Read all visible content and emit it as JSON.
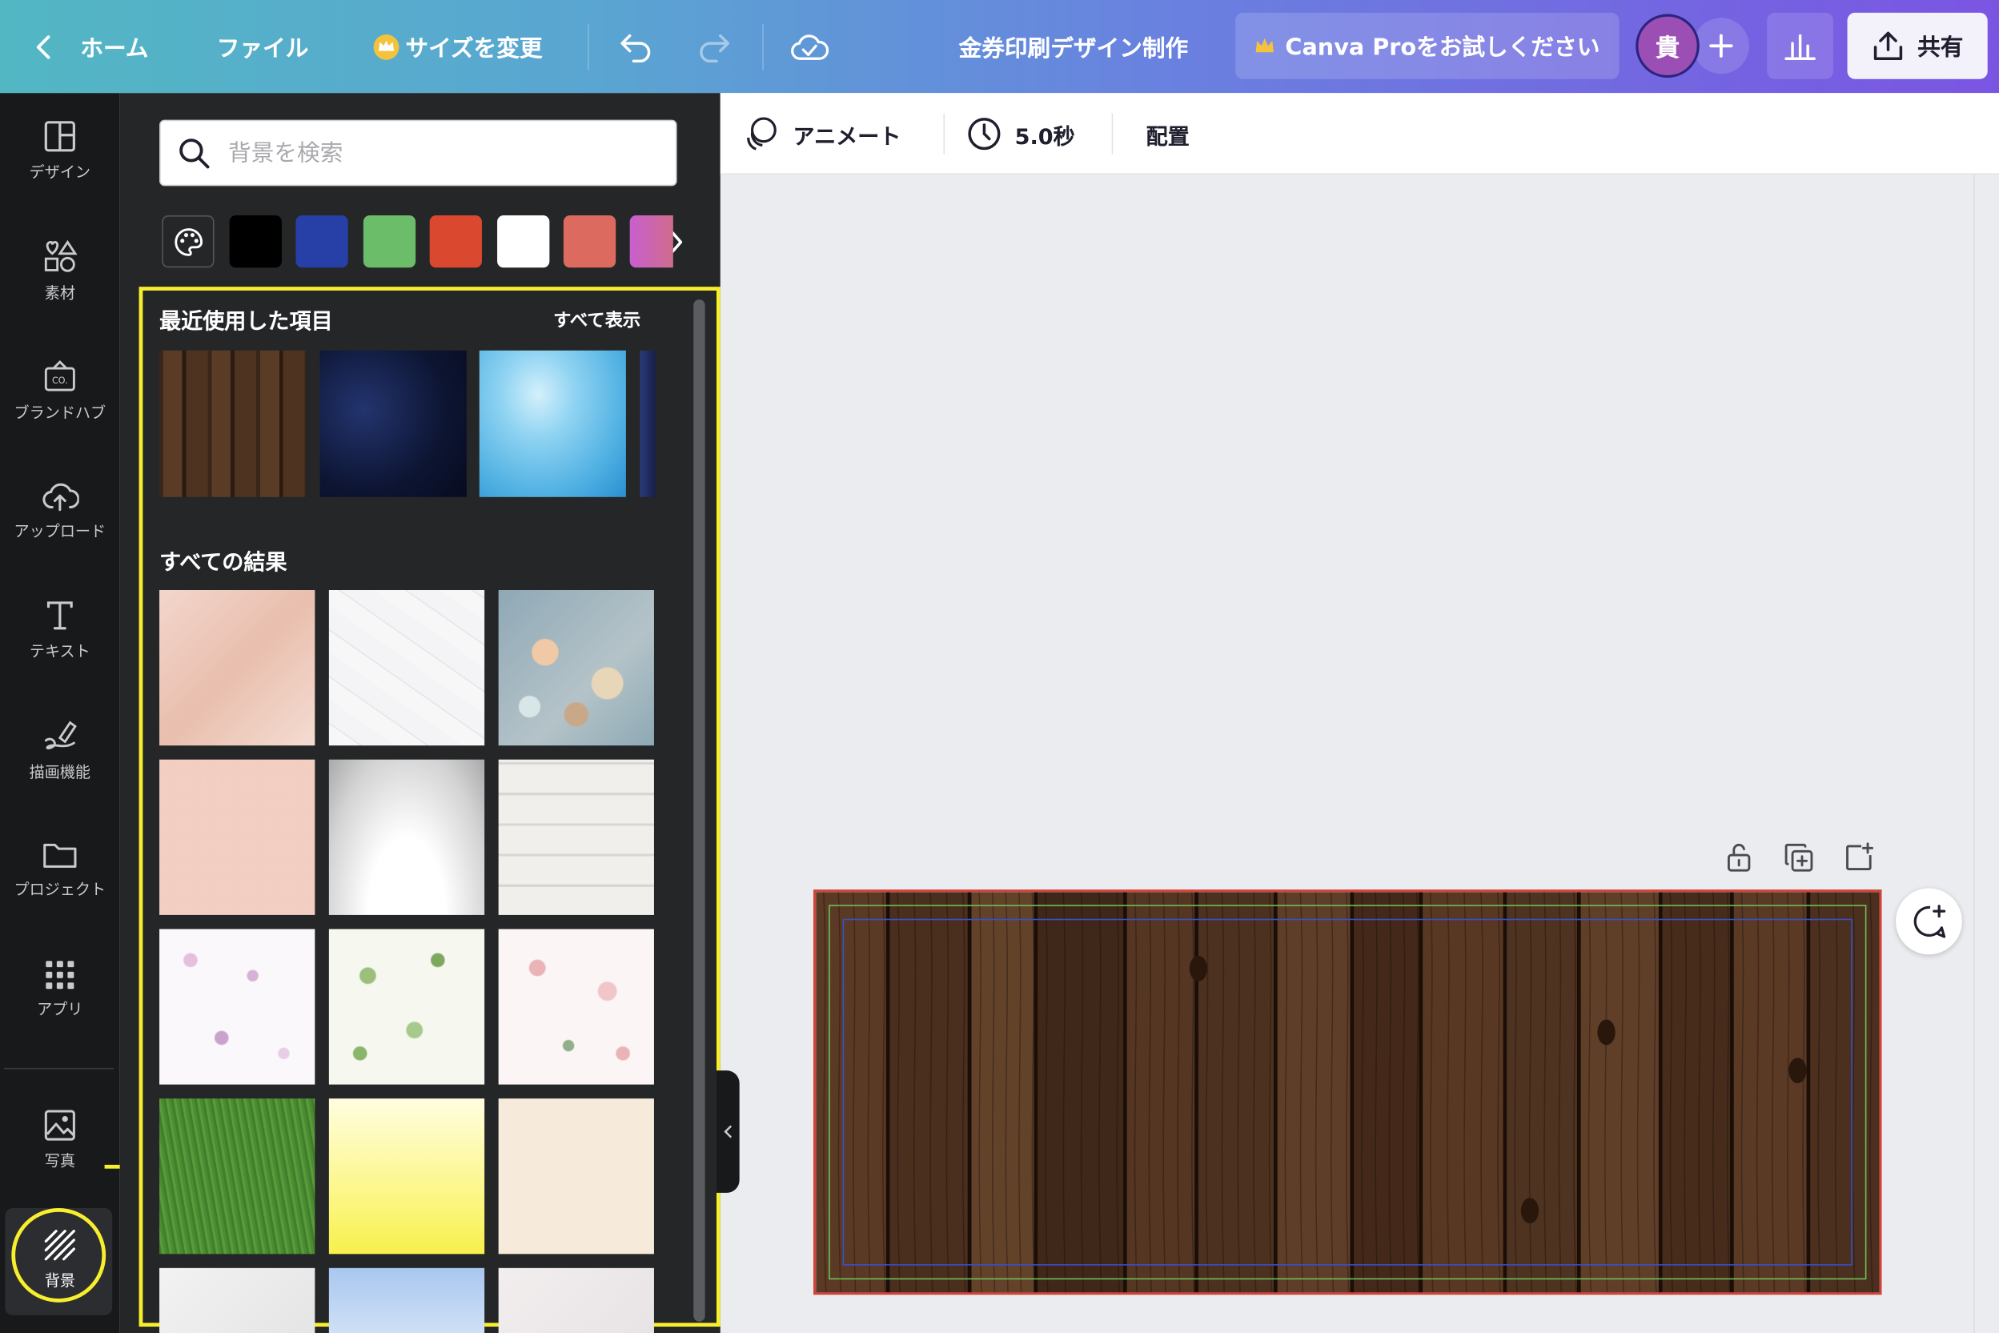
{
  "topbar": {
    "home_label": "ホーム",
    "file_label": "ファイル",
    "resize_label": "サイズを変更",
    "doc_title": "金券印刷デザイン制作",
    "promo_label": "Canva Proをお試しください",
    "avatar_initial": "貴",
    "share_label": "共有"
  },
  "rail": {
    "items": [
      {
        "label": "デザイン",
        "icon": "layout-icon"
      },
      {
        "label": "素材",
        "icon": "shapes-icon"
      },
      {
        "label": "ブランドハブ",
        "icon": "brand-icon"
      },
      {
        "label": "アップロード",
        "icon": "cloud-upload-icon"
      },
      {
        "label": "テキスト",
        "icon": "text-icon"
      },
      {
        "label": "描画機能",
        "icon": "draw-icon"
      },
      {
        "label": "プロジェクト",
        "icon": "folder-icon"
      },
      {
        "label": "アプリ",
        "icon": "apps-grid-icon"
      },
      {
        "label": "写真",
        "icon": "photo-icon"
      },
      {
        "label": "背景",
        "icon": "background-icon"
      }
    ],
    "active": "背景"
  },
  "panel": {
    "search_placeholder": "背景を検索",
    "swatches": [
      "#000000",
      "#2740a8",
      "#6bbd6a",
      "#d9482f",
      "#ffffff",
      "#dc6a5f",
      "#c85fd0"
    ],
    "recent_title": "最近使用した項目",
    "see_all": "すべて表示",
    "results_title": "すべての結果",
    "recent_items": [
      "dark-wood",
      "night-sky",
      "blue-water",
      "navy-blue"
    ],
    "results": [
      "pink-marble",
      "white-marble",
      "bokeh-lights",
      "pink-dots",
      "grey-gradient",
      "white-wood",
      "purple-petals",
      "green-leaves",
      "pink-roses",
      "green-grass",
      "yellow-gradient",
      "cream",
      "white-texture",
      "sky-blossom",
      "pale-floral"
    ]
  },
  "context": {
    "animate_label": "アニメート",
    "duration_label": "5.0秒",
    "arrange_label": "配置"
  },
  "colors": {
    "highlight": "#f7ee2e",
    "bleed_guide": "#d1433a",
    "margin_guide": "#6fbf5b",
    "safe_guide": "#3a4fc8"
  }
}
